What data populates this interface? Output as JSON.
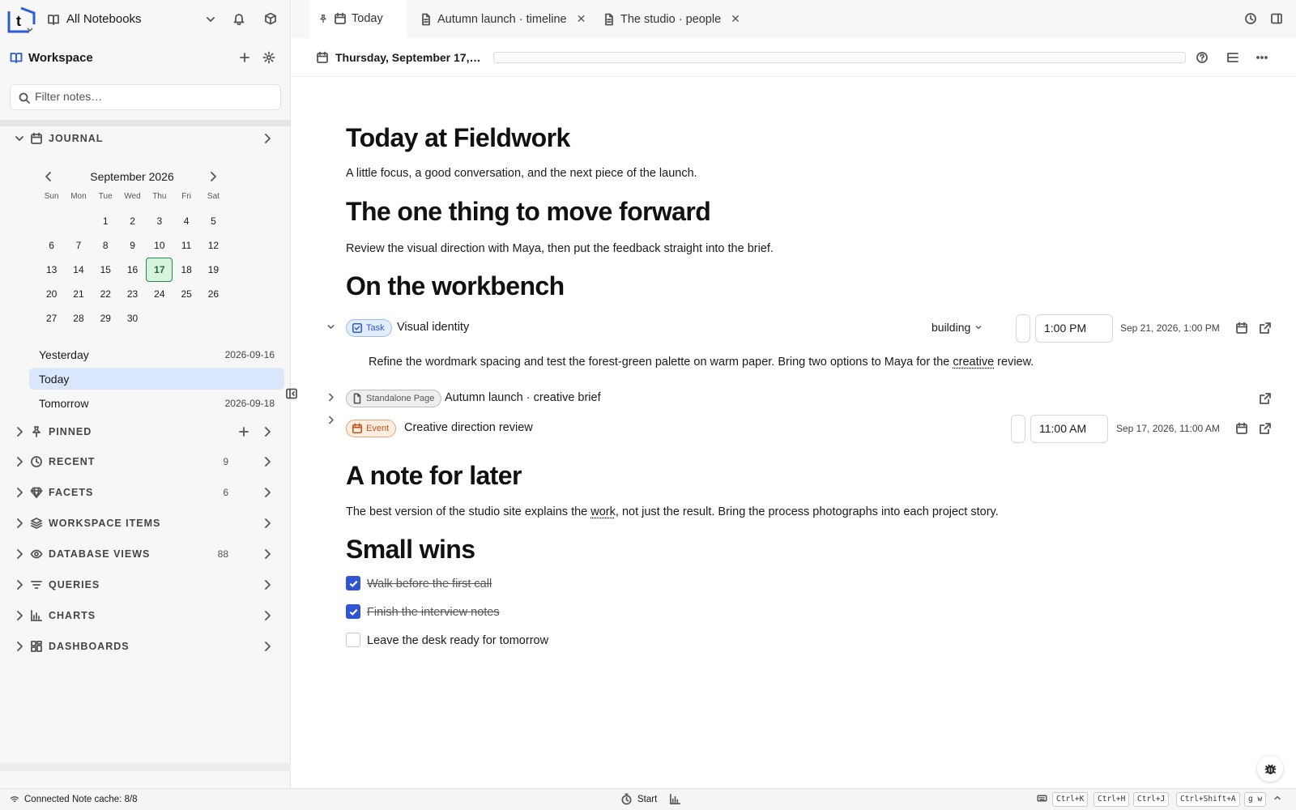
{
  "top": {
    "notebook_label": "All Notebooks"
  },
  "workspace": {
    "label": "Workspace",
    "filter_placeholder": "Filter notes…"
  },
  "journal": {
    "label": "JOURNAL",
    "month_title": "September 2026",
    "dow": [
      "Sun",
      "Mon",
      "Tue",
      "Wed",
      "Thu",
      "Fri",
      "Sat"
    ],
    "days": [
      "",
      "",
      "1",
      "2",
      "3",
      "4",
      "5",
      "6",
      "7",
      "8",
      "9",
      "10",
      "11",
      "12",
      "13",
      "14",
      "15",
      "16",
      "17",
      "18",
      "19",
      "20",
      "21",
      "22",
      "23",
      "24",
      "25",
      "26",
      "27",
      "28",
      "29",
      "30"
    ],
    "today_day": "17",
    "shortcuts": [
      {
        "label": "Yesterday",
        "date": "2026-09-16"
      },
      {
        "label": "Today",
        "date": ""
      },
      {
        "label": "Tomorrow",
        "date": "2026-09-18"
      }
    ]
  },
  "sections": [
    {
      "key": "pinned",
      "label": "PINNED",
      "count": "",
      "icon": "pin-icon"
    },
    {
      "key": "recent",
      "label": "RECENT",
      "count": "9",
      "icon": "clock-icon"
    },
    {
      "key": "facets",
      "label": "FACETS",
      "count": "6",
      "icon": "gem-icon"
    },
    {
      "key": "workspace_items",
      "label": "WORKSPACE ITEMS",
      "count": "",
      "icon": "layers-icon"
    },
    {
      "key": "database_views",
      "label": "DATABASE VIEWS",
      "count": "88",
      "icon": "eye-icon"
    },
    {
      "key": "queries",
      "label": "QUERIES",
      "count": "",
      "icon": "filter-icon"
    },
    {
      "key": "charts",
      "label": "CHARTS",
      "count": "",
      "icon": "bar-chart-icon"
    },
    {
      "key": "dashboards",
      "label": "DASHBOARDS",
      "count": "",
      "icon": "dashboard-icon"
    }
  ],
  "tabs": [
    {
      "label": "Today",
      "active": true
    },
    {
      "label": "Autumn launch · timeline",
      "active": false
    },
    {
      "label": "The studio · people",
      "active": false
    }
  ],
  "doc": {
    "date_title": "Thursday, September 17, 2…",
    "title": "Today at Fieldwork",
    "intro": "A little focus, a good conversation, and the next piece of the launch.",
    "h_forward": "The one thing to move forward",
    "p_forward": "Review the visual direction with Maya, then put the feedback straight into the brief.",
    "h_workbench": "On the workbench",
    "task": {
      "badge": "Task",
      "title": "Visual identity",
      "state": "building",
      "time": "1:00 PM",
      "when": "Sep 21, 2026, 1:00 PM",
      "desc_before": "Refine the wordmark spacing and test the forest-green palette on warm paper. Bring two options to Maya for the ",
      "desc_link": "creative",
      "desc_after": " review."
    },
    "page": {
      "badge": "Standalone Page",
      "title": "Autumn launch · creative brief"
    },
    "event": {
      "badge": "Event",
      "title": "Creative direction review",
      "time": "11:00 AM",
      "when": "Sep 17, 2026, 11:00 AM"
    },
    "h_later": "A note for later",
    "p_later_before": "The best version of the studio site explains the ",
    "p_later_link": "work",
    "p_later_after": ", not just the result. Bring the process photographs into each project story.",
    "h_wins": "Small wins",
    "wins": [
      {
        "label": "Walk before the first call",
        "done": true
      },
      {
        "label": "Finish the interview notes",
        "done": true
      },
      {
        "label": "Leave the desk ready for tomorrow",
        "done": false
      }
    ]
  },
  "status": {
    "connection": "Connected",
    "cache": "Note cache: 8/8",
    "timer_label": "Start",
    "shortcuts": [
      "Ctrl+K",
      "Ctrl+H",
      "Ctrl+J",
      "Ctrl+Shift+A",
      "g w"
    ]
  },
  "colors": {
    "accent": "#2d5bd7",
    "today_cell": "#d7f3de",
    "selected_row": "#d9e6fb",
    "event": "#c4551a"
  }
}
